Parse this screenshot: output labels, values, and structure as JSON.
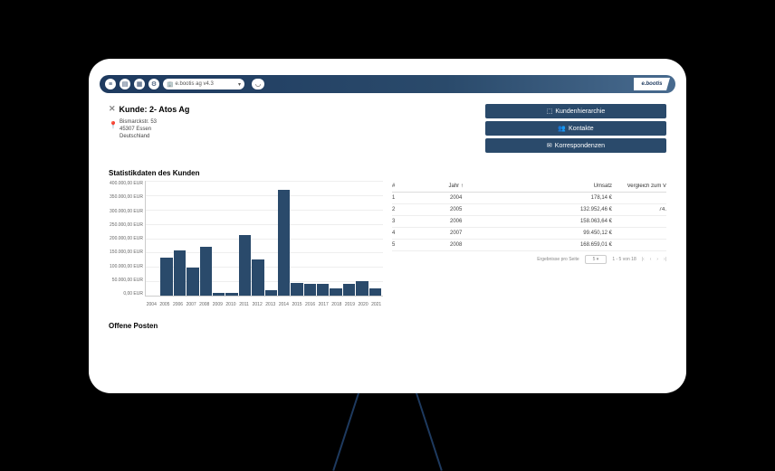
{
  "topbar": {
    "search": "e.bootis ag v4.3",
    "logo": "e.bootis"
  },
  "customer": {
    "title": "Kunde: 2- Atos Ag",
    "address": {
      "street": "Bismarckstr. 53",
      "city": "45307 Essen",
      "country": "Deutschland"
    },
    "buttons": {
      "hierarchy": "Kundenhierarchie",
      "contacts": "Kontakte",
      "corr": "Korrespondenzen"
    }
  },
  "stats_title": "Statistikdaten des Kunden",
  "chart_data": {
    "type": "bar",
    "xlabel": "",
    "ylabel": "",
    "ylim": [
      0,
      400000
    ],
    "y_ticks": [
      "400.000,00 EUR",
      "350.000,00 EUR",
      "300.000,00 EUR",
      "250.000,00 EUR",
      "200.000,00 EUR",
      "150.000,00 EUR",
      "100.000,00 EUR",
      "50.000,00 EUR",
      "0,00 EUR"
    ],
    "categories": [
      "2004",
      "2005",
      "2006",
      "2007",
      "2008",
      "2009",
      "2010",
      "2011",
      "2012",
      "2013",
      "2014",
      "2015",
      "2016",
      "2017",
      "2018",
      "2019",
      "2020",
      "2021"
    ],
    "values": [
      200,
      132000,
      158000,
      99000,
      169000,
      10000,
      10000,
      210000,
      125000,
      20000,
      370000,
      45000,
      40000,
      40000,
      25000,
      40000,
      50000,
      25000
    ]
  },
  "table": {
    "headers": {
      "idx": "#",
      "year": "Jahr",
      "rev": "Umsatz",
      "cmp": "Vergleich zum V"
    },
    "rows": [
      {
        "idx": "1",
        "year": "2004",
        "rev": "178,14 €",
        "cmp": ""
      },
      {
        "idx": "2",
        "year": "2005",
        "rev": "132.952,46 €",
        "cmp": "74."
      },
      {
        "idx": "3",
        "year": "2006",
        "rev": "158.063,64 €",
        "cmp": ""
      },
      {
        "idx": "4",
        "year": "2007",
        "rev": "99.450,12 €",
        "cmp": ""
      },
      {
        "idx": "5",
        "year": "2008",
        "rev": "168.659,01 €",
        "cmp": ""
      }
    ],
    "pager": {
      "label": "Ergebnisse pro Seite",
      "per": "5",
      "range": "1 - 5 von 18"
    }
  },
  "open_posts": "Offene Posten"
}
